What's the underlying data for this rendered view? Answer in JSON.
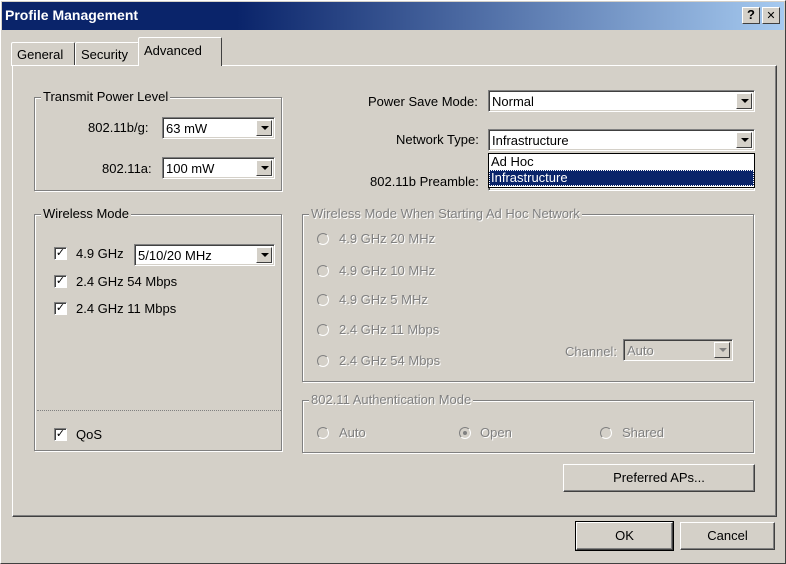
{
  "window": {
    "title": "Profile Management",
    "help_glyph": "?",
    "close_glyph": "✕"
  },
  "tabs": [
    {
      "label": "General"
    },
    {
      "label": "Security"
    },
    {
      "label": "Advanced",
      "active": true
    }
  ],
  "transmit_power": {
    "group_label": "Transmit Power Level",
    "bg_label": "802.11b/g:",
    "bg_value": "63 mW",
    "a_label": "802.11a:",
    "a_value": "100 mW"
  },
  "power_save": {
    "label": "Power Save Mode:",
    "value": "Normal"
  },
  "network_type": {
    "label": "Network Type:",
    "value": "Infrastructure",
    "options": [
      "Ad Hoc",
      "Infrastructure"
    ],
    "selected_option": "Infrastructure"
  },
  "preamble": {
    "label": "802.11b Preamble:"
  },
  "wireless_mode": {
    "group_label": "Wireless Mode",
    "items": [
      {
        "label": "4.9 GHz",
        "checked": true
      },
      {
        "label": "2.4 GHz 54 Mbps",
        "checked": true
      },
      {
        "label": "2.4 GHz 11 Mbps",
        "checked": true
      }
    ],
    "bandwidth_value": "5/10/20 MHz",
    "qos_label": "QoS",
    "qos_checked": true
  },
  "adhoc_mode": {
    "group_label": "Wireless Mode When Starting Ad Hoc Network",
    "options": [
      {
        "label": "4.9 GHz 20 MHz"
      },
      {
        "label": "4.9 GHz 10 MHz"
      },
      {
        "label": "4.9 GHz 5 MHz"
      },
      {
        "label": "2.4 GHz 11 Mbps"
      },
      {
        "label": "2.4 GHz 54 Mbps"
      }
    ],
    "channel_label": "Channel:",
    "channel_value": "Auto"
  },
  "auth_mode": {
    "group_label": "802.11 Authentication Mode",
    "options": [
      {
        "label": "Auto",
        "selected": false
      },
      {
        "label": "Open",
        "selected": true
      },
      {
        "label": "Shared",
        "selected": false
      }
    ]
  },
  "buttons": {
    "preferred_aps": "Preferred APs...",
    "ok": "OK",
    "cancel": "Cancel"
  },
  "check_glyph": "✓",
  "colors": {
    "face": "#d4d0c8",
    "title_bar": "#0a246a",
    "selection": "#0a246a",
    "disabled_text": "#808080"
  }
}
